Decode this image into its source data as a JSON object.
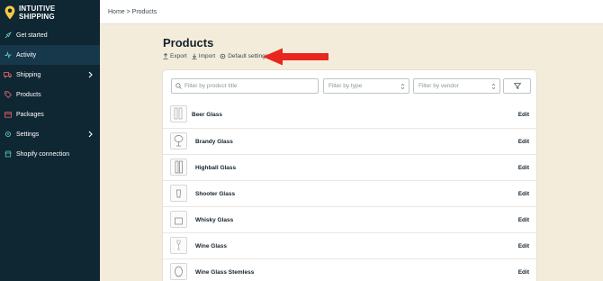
{
  "brand": {
    "line1": "INTUITIVE",
    "line2": "SHIPPING",
    "accent": "#f6c944",
    "sidebar_bg": "#0f2633"
  },
  "sidebar": {
    "items": [
      {
        "label": "Get started",
        "icon": "rocket-icon"
      },
      {
        "label": "Activity",
        "icon": "activity-icon",
        "active": true
      },
      {
        "label": "Shipping",
        "icon": "truck-icon",
        "chevron": true
      },
      {
        "label": "Products",
        "icon": "tag-icon"
      },
      {
        "label": "Packages",
        "icon": "package-icon"
      },
      {
        "label": "Settings",
        "icon": "gear-icon",
        "chevron": true
      },
      {
        "label": "Shopify connection",
        "icon": "shop-icon"
      }
    ]
  },
  "breadcrumb": {
    "text": "Home > Products"
  },
  "page": {
    "title": "Products",
    "actions": {
      "export": "Export",
      "import": "Import",
      "default_settings": "Default settings"
    }
  },
  "annotation_arrow_color": "#e8271e",
  "filters": {
    "search_placeholder": "Filter by product title",
    "type_placeholder": "Filter by type",
    "vendor_placeholder": "Filter by vendor"
  },
  "products": [
    {
      "name": "Beer Glass",
      "edit": "Edit"
    },
    {
      "name": "Brandy Glass",
      "edit": "Edit"
    },
    {
      "name": "Highball Glass",
      "edit": "Edit"
    },
    {
      "name": "Shooter Glass",
      "edit": "Edit"
    },
    {
      "name": "Whisky Glass",
      "edit": "Edit"
    },
    {
      "name": "Wine Glass",
      "edit": "Edit"
    },
    {
      "name": "Wine Glass Stemless",
      "edit": "Edit"
    }
  ]
}
